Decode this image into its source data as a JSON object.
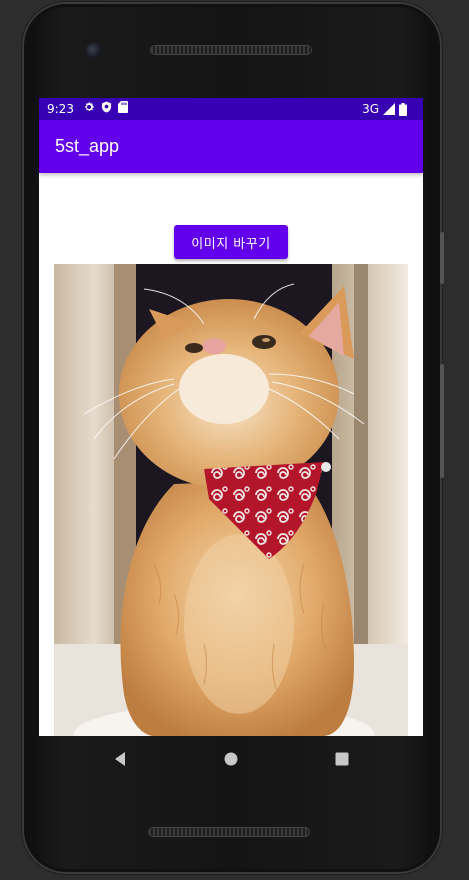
{
  "status_bar": {
    "time": "9:23",
    "network": "3G",
    "icons": [
      "settings-icon",
      "shield-icon",
      "sd-card-icon",
      "signal-icon",
      "battery-icon"
    ]
  },
  "app_bar": {
    "title": "5st_app"
  },
  "main": {
    "change_image_button": "이미지 바꾸기",
    "image_subject": "orange tabby cat wearing red bandana"
  },
  "nav_bar": {
    "icons": [
      "back-icon",
      "home-icon",
      "recents-icon"
    ]
  },
  "colors": {
    "status_bar": "#3700b3",
    "primary": "#6200ee",
    "screen_bg": "#ffffff"
  }
}
